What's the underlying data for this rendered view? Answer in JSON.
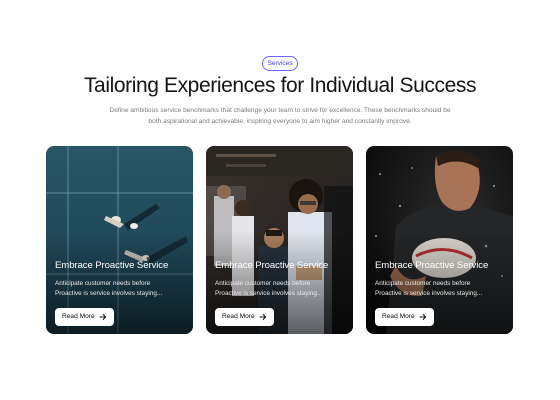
{
  "badge": "Services",
  "title": "Tailoring Experiences for Individual Success",
  "subtitle_lines": [
    "Define ambitious service benchmarks that challenge your team to strive for excellence. These benchmarks should be",
    "both aspirational and achievable, inspiring everyone to aim higher and constantly improve."
  ],
  "cards": [
    {
      "title": "Embrace Proactive Service",
      "text_lines": [
        "Anticipate customer needs before",
        "Proactive is service involves staying..."
      ],
      "button": "Read More",
      "icon": "arrow-right-icon"
    },
    {
      "title": "Embrace Proactive Service",
      "text_lines": [
        "Anticipate customer needs before",
        "Proactive is service involves staying..."
      ],
      "button": "Read More",
      "icon": "arrow-right-icon"
    },
    {
      "title": "Embrace Proactive Service",
      "text_lines": [
        "Anticipate customer needs before",
        "Proactive is service involves staying..."
      ],
      "button": "Read More",
      "icon": "arrow-right-icon"
    }
  ],
  "colors": {
    "accent": "#6c63ff",
    "heading": "#151515",
    "muted": "#7b7b7b"
  }
}
